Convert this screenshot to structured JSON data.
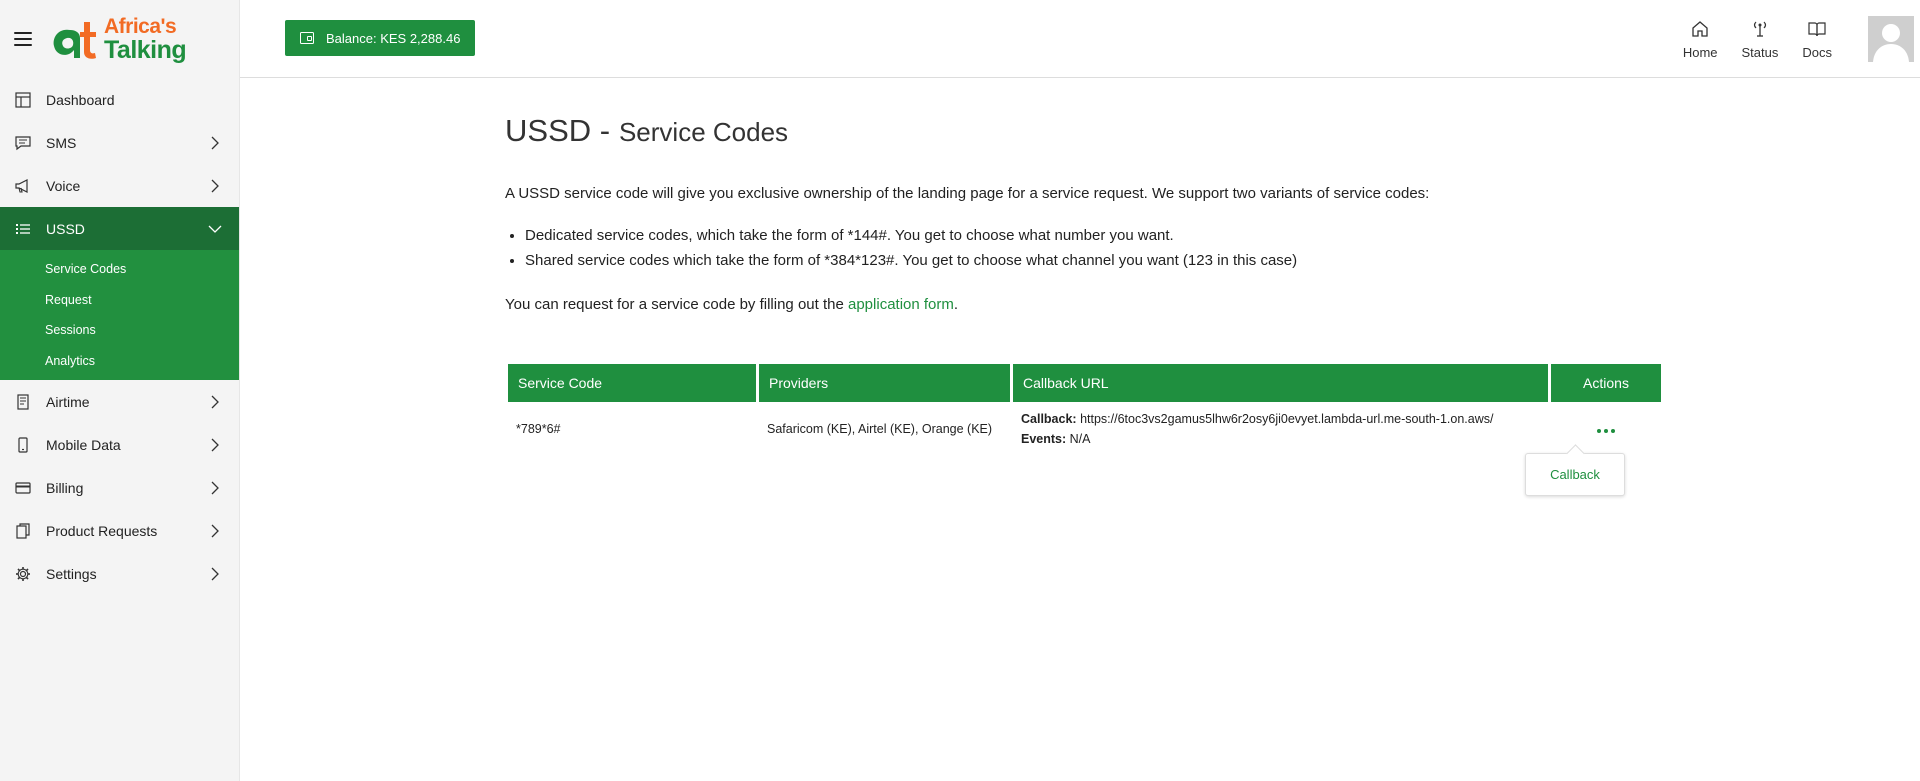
{
  "brand": {
    "line1": "Africa's",
    "line2": "Talking"
  },
  "sidebar": {
    "items": [
      {
        "label": "Dashboard",
        "icon": "dashboard-icon"
      },
      {
        "label": "SMS",
        "icon": "message-icon"
      },
      {
        "label": "Voice",
        "icon": "megaphone-icon"
      },
      {
        "label": "USSD",
        "icon": "list-icon"
      },
      {
        "label": "Airtime",
        "icon": "receipt-icon"
      },
      {
        "label": "Mobile Data",
        "icon": "phone-icon"
      },
      {
        "label": "Billing",
        "icon": "card-icon"
      },
      {
        "label": "Product Requests",
        "icon": "files-icon"
      },
      {
        "label": "Settings",
        "icon": "gear-icon"
      }
    ],
    "ussd_sub": [
      "Service Codes",
      "Request",
      "Sessions",
      "Analytics"
    ]
  },
  "topbar": {
    "balance": "Balance: KES 2,288.46",
    "nav": {
      "home": "Home",
      "status": "Status",
      "docs": "Docs"
    }
  },
  "page": {
    "title_main": "USSD -",
    "title_sub": "Service Codes",
    "intro": "A USSD service code will give you exclusive ownership of the landing page for a service request. We support two variants of service codes:",
    "bullets": [
      "Dedicated service codes, which take the form of *144#. You get to choose what number you want.",
      "Shared service codes which take the form of *384*123#. You get to choose what channel you want (123 in this case)"
    ],
    "request_prefix": "You can request for a service code by filling out the",
    "request_link": "application form",
    "request_suffix": "."
  },
  "table": {
    "headers": [
      "Service Code",
      "Providers",
      "Callback URL",
      "Actions"
    ],
    "rows": [
      {
        "code": "*789*6#",
        "providers": "Safaricom (KE), Airtel (KE), Orange (KE)",
        "callback_label": "Callback:",
        "callback_url": "https://6toc3vs2gamus5lhw6r2osy6ji0evyet.lambda-url.me-south-1.on.aws/",
        "events_label": "Events:",
        "events_value": "N/A"
      }
    ]
  },
  "popover": {
    "label": "Callback"
  },
  "colors": {
    "green": "#1f8f3f",
    "dark_green": "#1c6e35",
    "orange": "#f26b24"
  }
}
